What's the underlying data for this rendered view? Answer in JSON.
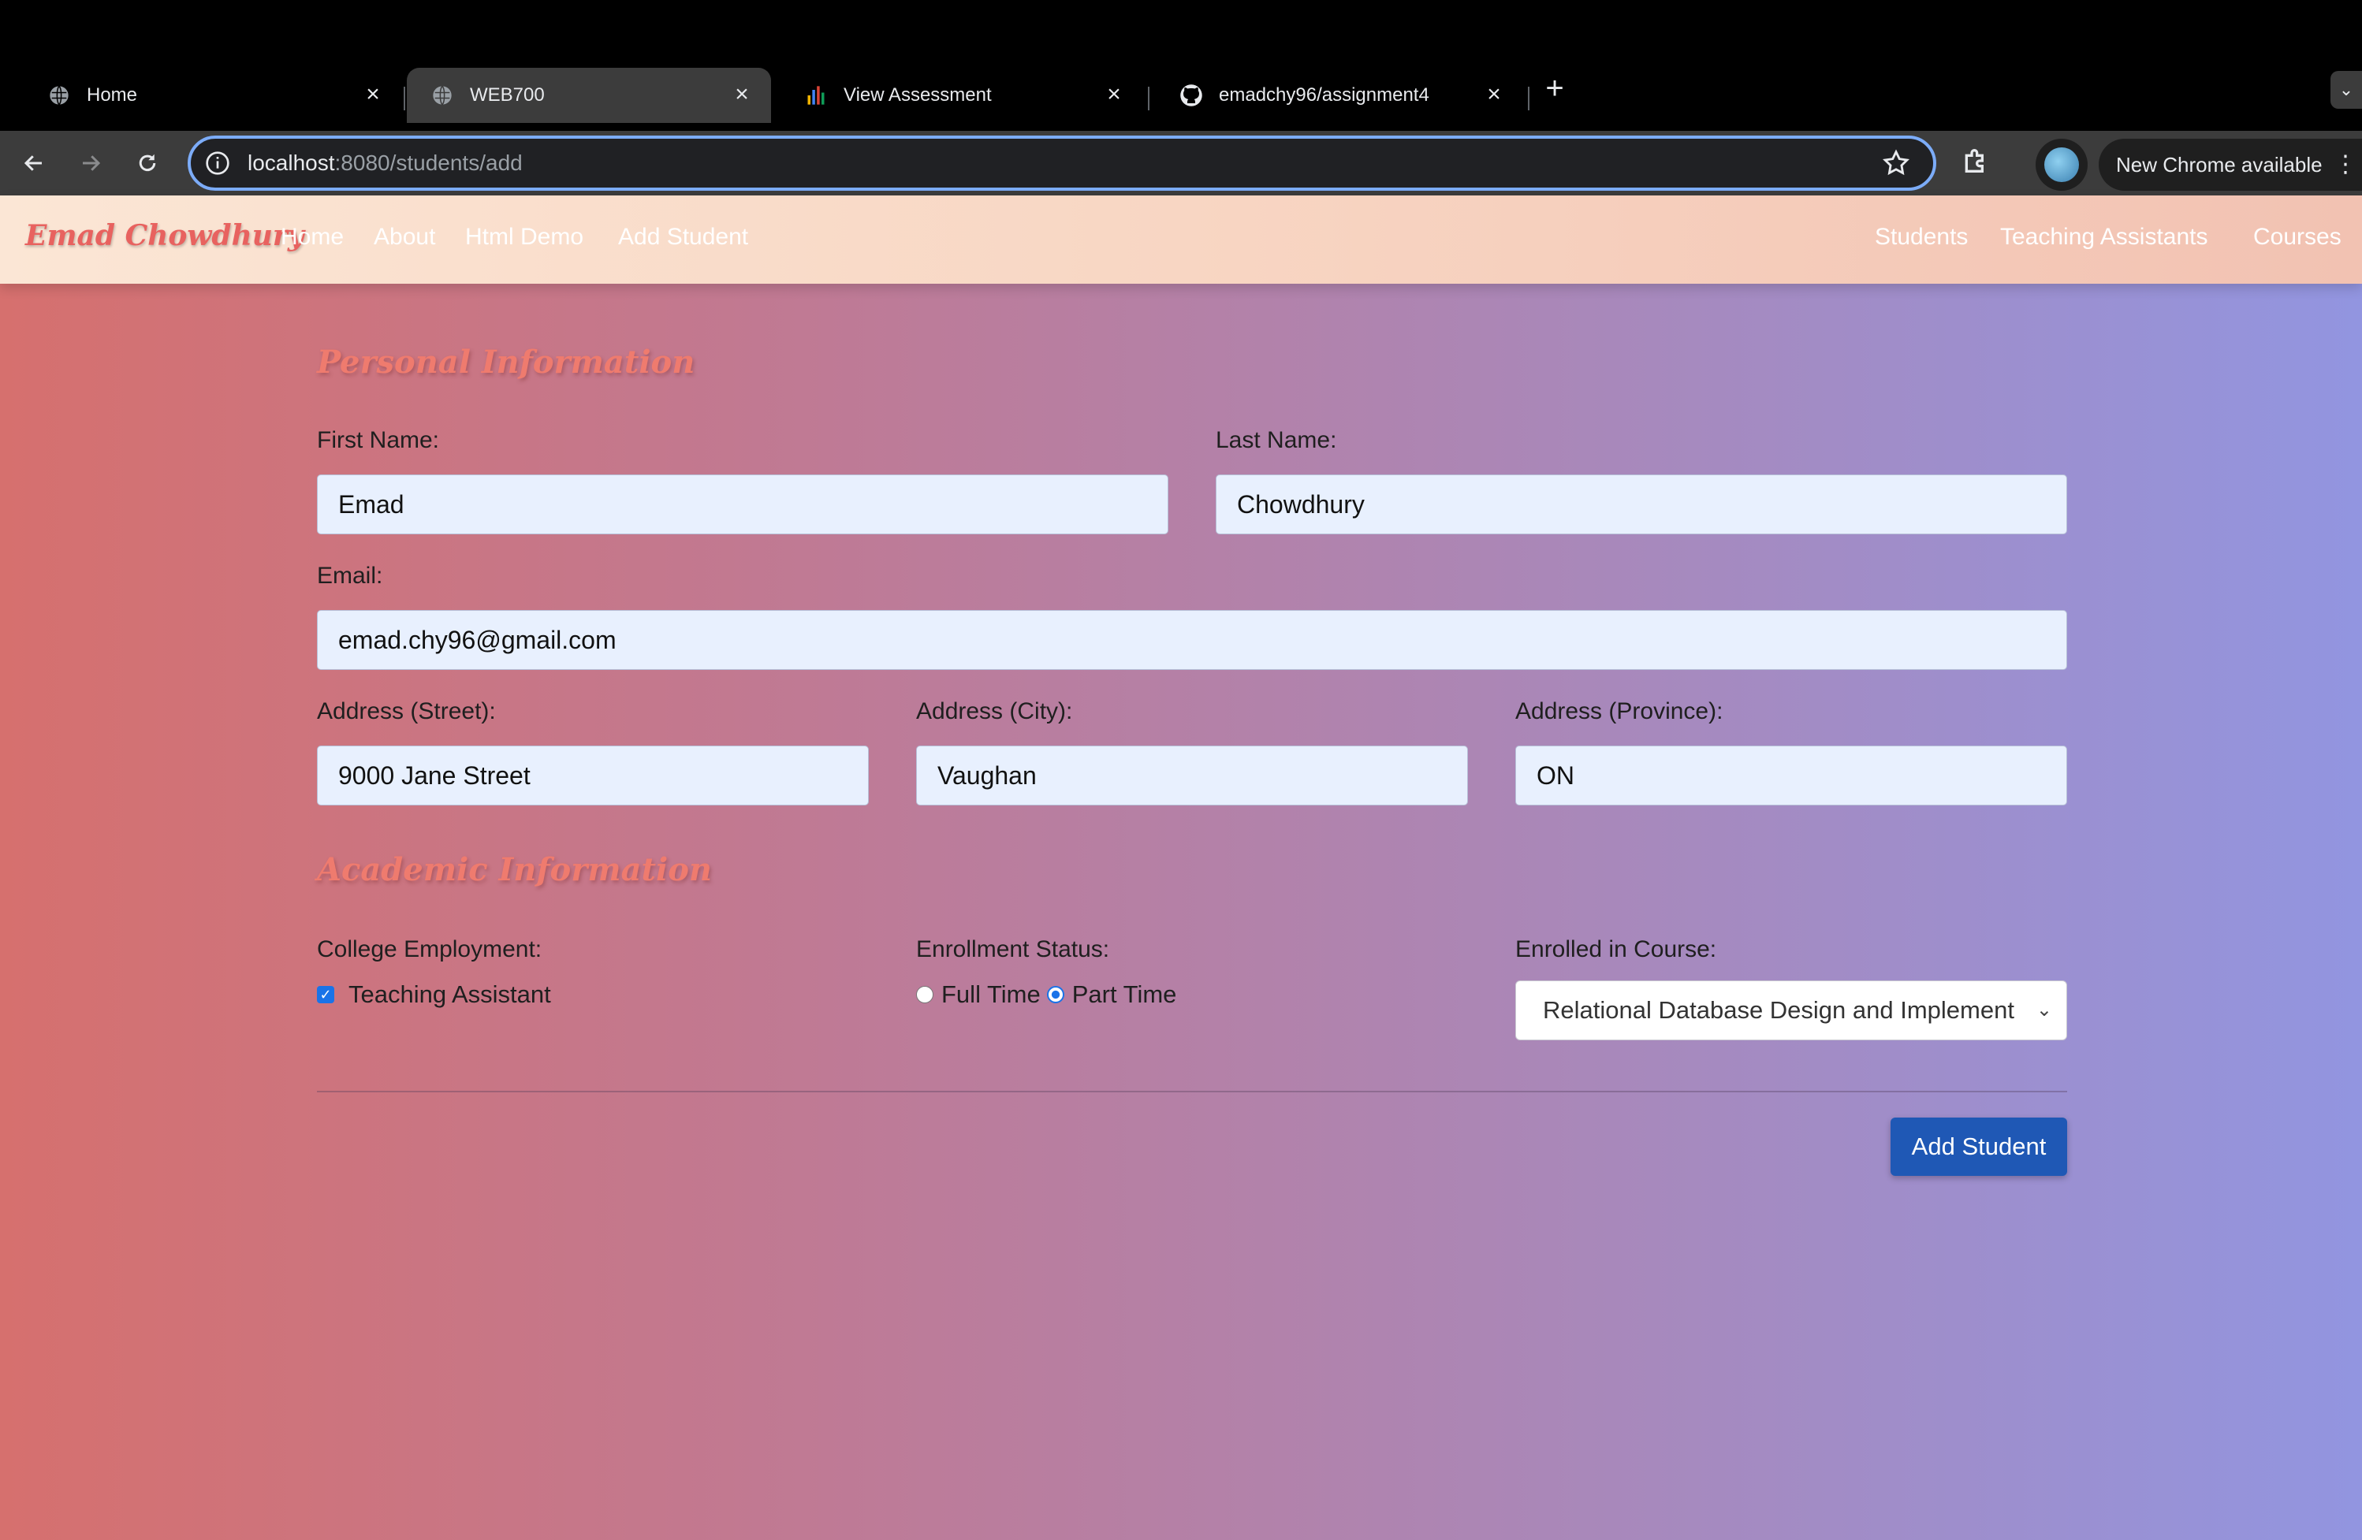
{
  "browser": {
    "tabs": [
      {
        "title": "Home",
        "icon": "globe-icon",
        "active": false
      },
      {
        "title": "WEB700",
        "icon": "globe-icon",
        "active": true
      },
      {
        "title": "View Assessment",
        "icon": "bar-chart-icon",
        "active": false
      },
      {
        "title": "emadchy96/assignment4",
        "icon": "github-icon",
        "active": false
      }
    ],
    "close_glyph": "×",
    "url_host": "localhost",
    "url_path": ":8080/students/add",
    "update_chip": "New Chrome available"
  },
  "navbar": {
    "brand": "Emad Chowdhury",
    "left_links": [
      "Home",
      "About",
      "Html Demo",
      "Add Student"
    ],
    "right_links": [
      "Students",
      "Teaching Assistants",
      "Courses"
    ]
  },
  "form": {
    "personal_title": "Personal Information",
    "first_name_label": "First Name:",
    "first_name_value": "Emad",
    "last_name_label": "Last Name:",
    "last_name_value": "Chowdhury",
    "email_label": "Email:",
    "email_value": "emad.chy96@gmail.com",
    "street_label": "Address (Street):",
    "street_value": "9000 Jane Street",
    "city_label": "Address (City):",
    "city_value": "Vaughan",
    "province_label": "Address (Province):",
    "province_value": "ON",
    "academic_title": "Academic Information",
    "employment_label": "College Employment:",
    "ta_checkbox_label": "Teaching Assistant",
    "ta_checked": true,
    "enrollment_label": "Enrollment Status:",
    "full_time_label": "Full Time",
    "part_time_label": "Part Time",
    "enrollment_selected": "Part Time",
    "course_label": "Enrolled in Course:",
    "course_value": "Relational Database Design and Implement",
    "submit_label": "Add Student"
  },
  "colors": {
    "brand": "#e8625f",
    "section_title": "#ef7b6e",
    "submit_button": "#1f58b5",
    "input_bg": "#e8f0fe",
    "omnibox_focus": "#7cacf8"
  }
}
